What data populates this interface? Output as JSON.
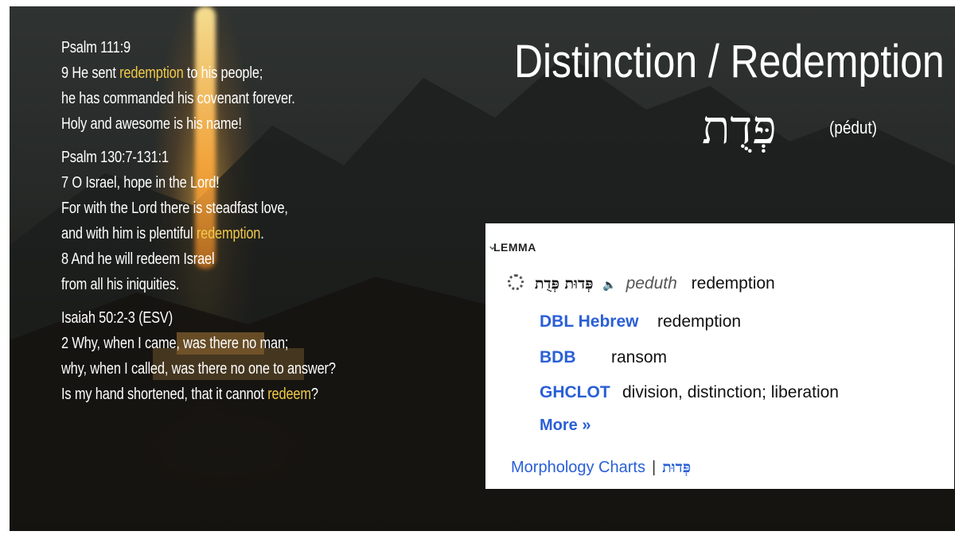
{
  "slide": {
    "title": "Distinction / Redemption",
    "hebrew_word": "פְּדֻת",
    "transliteration": "(pédut)"
  },
  "verses": {
    "block1": {
      "ref": "Psalm 111:9",
      "lines": [
        {
          "pre": "9 He sent ",
          "hl": "redemption",
          "post": " to his people;"
        },
        {
          "pre": "he has commanded his covenant forever.",
          "hl": "",
          "post": ""
        },
        {
          "pre": "Holy and awesome is his name!",
          "hl": "",
          "post": ""
        }
      ]
    },
    "block2": {
      "ref": "Psalm 130:7-131:1",
      "lines": [
        {
          "pre": "7 O Israel, hope in the Lord!",
          "hl": "",
          "post": ""
        },
        {
          "pre": "For with the Lord there is steadfast love,",
          "hl": "",
          "post": ""
        },
        {
          "pre": "and with him is plentiful ",
          "hl": "redemption",
          "post": "."
        },
        {
          "pre": "8 And he will redeem Israel",
          "hl": "",
          "post": ""
        },
        {
          "pre": "from all his iniquities.",
          "hl": "",
          "post": ""
        }
      ]
    },
    "block3": {
      "ref": "Isaiah 50:2-3 (ESV)",
      "lines": [
        {
          "pre": "2 Why, when I came, was there no man;",
          "hl": "",
          "post": ""
        },
        {
          "pre": "why, when I called, was there no one to answer?",
          "hl": "",
          "post": ""
        },
        {
          "pre": " Is my hand shortened, that it cannot ",
          "hl": "redeem",
          "post": "?"
        }
      ]
    }
  },
  "lemma": {
    "heading": "LEMMA",
    "hebrew_forms": "פְּדוּת פְּדֻת",
    "hebrew_alt": "פְּדוּת",
    "translit": "peduth",
    "gloss": "redemption",
    "definitions": [
      {
        "source": "DBL Hebrew",
        "text": "redemption"
      },
      {
        "source": "BDB",
        "text": "ransom"
      },
      {
        "source": "GHCLOT",
        "text": "division, distinction; liberation"
      }
    ],
    "more_label": "More »",
    "morph_label": "Morphology Charts",
    "morph_hebrew": "פְּדוּת"
  },
  "colors": {
    "highlight": "#f1c94a",
    "link": "#2a5fd6"
  },
  "icons": {
    "collapse": "chevron-down-icon",
    "loading": "spinner-icon",
    "audio": "speaker-icon"
  }
}
